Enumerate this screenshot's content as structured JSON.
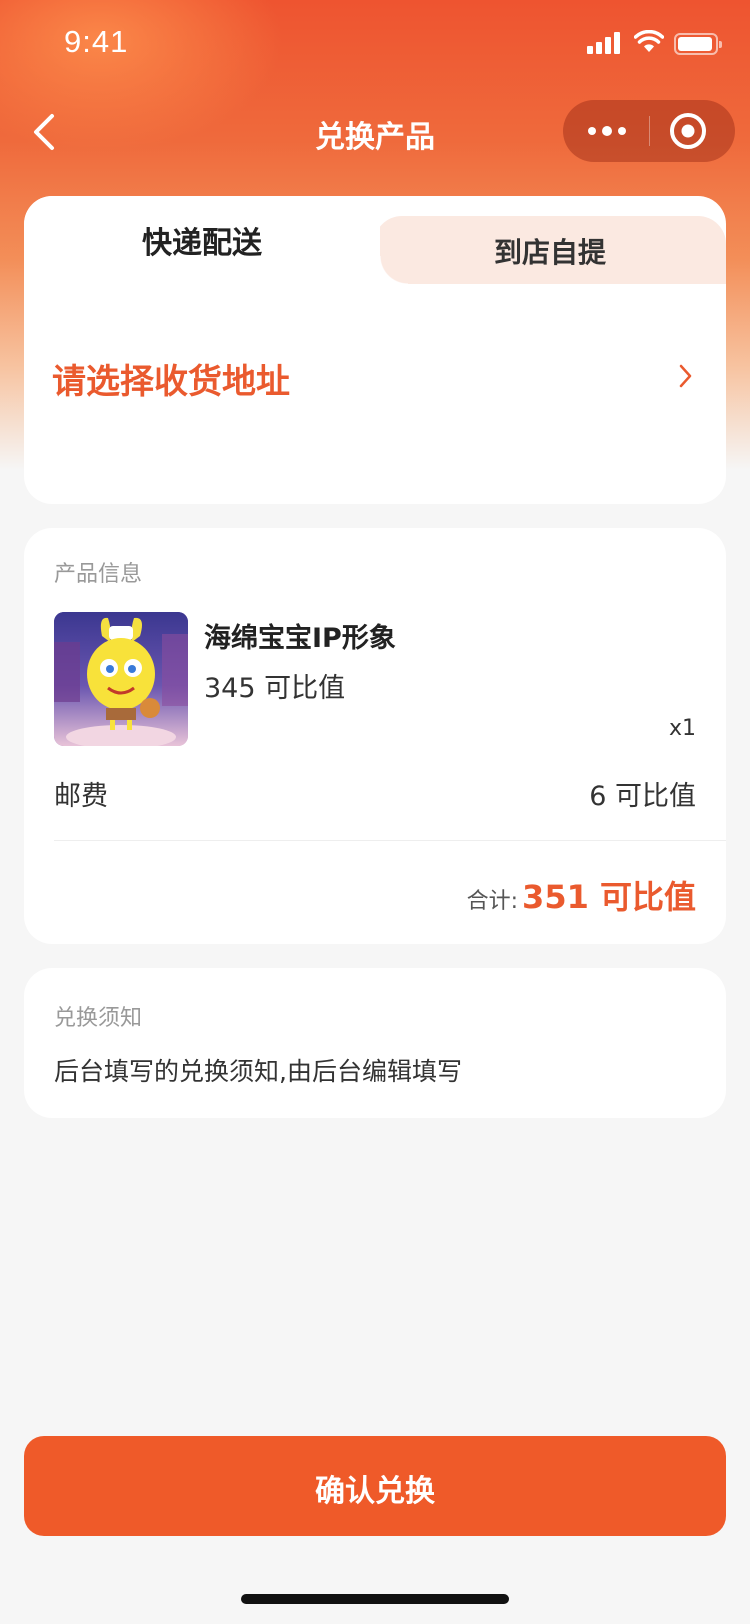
{
  "status_bar": {
    "time": "9:41"
  },
  "nav": {
    "title": "兑换产品"
  },
  "delivery": {
    "tabs": [
      {
        "label": "快递配送",
        "active": true
      },
      {
        "label": "到店自提",
        "active": false
      }
    ],
    "address_prompt": "请选择收货地址"
  },
  "product_section": {
    "label": "产品信息",
    "product": {
      "name": "海绵宝宝IP形象",
      "price": "345 可比值",
      "quantity": "x1"
    },
    "shipping": {
      "label": "邮费",
      "value": "6 可比值"
    },
    "total": {
      "label": "合计:",
      "value": "351 可比值"
    }
  },
  "notice": {
    "label": "兑换须知",
    "text": "后台填写的兑换须知,由后台编辑填写"
  },
  "confirm": {
    "label": "确认兑换"
  },
  "colors": {
    "accent": "#ea5a2e",
    "button": "#ef5a29",
    "tab_inactive_bg": "#fbe9e1"
  }
}
